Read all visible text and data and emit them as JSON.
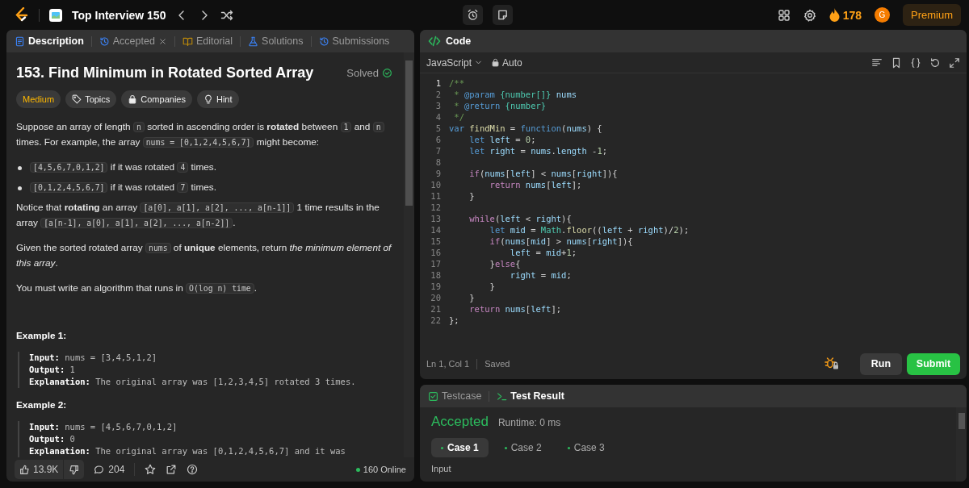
{
  "top_bar": {
    "list_title": "Top Interview 150",
    "streak": "178",
    "avatar": "G",
    "premium": "Premium"
  },
  "description_tabs": [
    {
      "label": "Description",
      "selected": true,
      "closable": false
    },
    {
      "label": "Accepted",
      "selected": false,
      "closable": true
    },
    {
      "label": "Editorial",
      "selected": false,
      "closable": false
    },
    {
      "label": "Solutions",
      "selected": false,
      "closable": false
    },
    {
      "label": "Submissions",
      "selected": false,
      "closable": false
    }
  ],
  "problem": {
    "title": "153. Find Minimum in Rotated Sorted Array",
    "status": "Solved",
    "difficulty": "Medium",
    "tags": [
      "Topics",
      "Companies",
      "Hint"
    ],
    "statement": [
      {
        "kind": "para",
        "parts": [
          {
            "text": "Suppose an array of length "
          },
          {
            "code": "n"
          },
          {
            "text": " sorted in ascending order is **rotated** between "
          },
          {
            "code": "1"
          },
          {
            "text": " and "
          },
          {
            "code": "n"
          },
          {
            "text": " times. For example, the array "
          },
          {
            "code": "nums = [0,1,2,4,5,6,7]"
          },
          {
            "text": " might become:"
          }
        ]
      },
      {
        "kind": "bullet",
        "parts": [
          {
            "code": "[4,5,6,7,0,1,2]"
          },
          {
            "text": " if it was rotated "
          },
          {
            "code": "4"
          },
          {
            "text": " times."
          }
        ]
      },
      {
        "kind": "bullet",
        "parts": [
          {
            "code": "[0,1,2,4,5,6,7]"
          },
          {
            "text": " if it was rotated "
          },
          {
            "code": "7"
          },
          {
            "text": " times."
          }
        ]
      },
      {
        "kind": "para",
        "parts": [
          {
            "text": "Notice that **rotating** an array "
          },
          {
            "code": "[a[0], a[1], a[2], ..., a[n-1]]"
          },
          {
            "text": " 1 time results in the array "
          },
          {
            "code": "[a[n-1], a[0], a[1], a[2], ..., a[n-2]]"
          },
          {
            "text": "."
          }
        ]
      },
      {
        "kind": "para",
        "parts": [
          {
            "text": "Given the sorted rotated array "
          },
          {
            "code": "nums"
          },
          {
            "text": " of **unique** elements, return *the minimum element of this array*."
          }
        ]
      },
      {
        "kind": "para",
        "parts": [
          {
            "text": "You must write an algorithm that runs in "
          },
          {
            "code": "O(log n) time"
          },
          {
            "text": "."
          }
        ]
      }
    ],
    "examples": [
      {
        "title": "Example 1:",
        "lines": [
          "**Input:** nums = [3,4,5,1,2]",
          "**Output:** 1",
          "**Explanation:** The original array was [1,2,3,4,5] rotated 3 times."
        ]
      },
      {
        "title": "Example 2:",
        "lines": [
          "**Input:** nums = [4,5,6,7,0,1,2]",
          "**Output:** 0",
          "**Explanation:** The original array was [0,1,2,4,5,6,7] and it was"
        ]
      }
    ]
  },
  "footer": {
    "likes": "13.9K",
    "comments": "204",
    "online": "160 Online"
  },
  "code_panel": {
    "title": "Code",
    "language": "JavaScript",
    "mode": "Auto",
    "lines": [
      {
        "number": "1",
        "current": true,
        "tokens": [
          {
            "kind": "cm",
            "text": "/**"
          }
        ]
      },
      {
        "number": "2",
        "current": false,
        "tokens": [
          {
            "kind": "cm",
            "text": " * "
          },
          {
            "kind": "doc",
            "text": "@param"
          },
          {
            "kind": "type",
            "text": " {number[]}"
          },
          {
            "kind": "var",
            "text": " nums"
          }
        ]
      },
      {
        "number": "3",
        "current": false,
        "tokens": [
          {
            "kind": "cm",
            "text": " * "
          },
          {
            "kind": "doc",
            "text": "@return"
          },
          {
            "kind": "type",
            "text": " {number}"
          }
        ]
      },
      {
        "number": "4",
        "current": false,
        "tokens": [
          {
            "kind": "cm",
            "text": " */"
          }
        ]
      },
      {
        "number": "5",
        "current": false,
        "tokens": [
          {
            "kind": "kw",
            "text": "var"
          },
          {
            "kind": "fn",
            "text": " findMin"
          },
          {
            "kind": "p",
            "text": " = "
          },
          {
            "kind": "kw",
            "text": "function"
          },
          {
            "kind": "p",
            "text": "("
          },
          {
            "kind": "var",
            "text": "nums"
          },
          {
            "kind": "p",
            "text": ") {"
          }
        ]
      },
      {
        "number": "6",
        "current": false,
        "tokens": [
          {
            "kind": "kw",
            "text": "    let"
          },
          {
            "kind": "var",
            "text": " left"
          },
          {
            "kind": "p",
            "text": " = "
          },
          {
            "kind": "num",
            "text": "0"
          },
          {
            "kind": "p",
            "text": ";"
          }
        ]
      },
      {
        "number": "7",
        "current": false,
        "tokens": [
          {
            "kind": "kw",
            "text": "    let"
          },
          {
            "kind": "var",
            "text": " right"
          },
          {
            "kind": "p",
            "text": " = "
          },
          {
            "kind": "var",
            "text": "nums"
          },
          {
            "kind": "p",
            "text": "."
          },
          {
            "kind": "var",
            "text": "length"
          },
          {
            "kind": "p",
            "text": " -"
          },
          {
            "kind": "num",
            "text": "1"
          },
          {
            "kind": "p",
            "text": ";"
          }
        ]
      },
      {
        "number": "8",
        "current": false
      },
      {
        "number": "9",
        "current": false,
        "tokens": [
          {
            "kind": "ctl",
            "text": "    if"
          },
          {
            "kind": "p",
            "text": "("
          },
          {
            "kind": "var",
            "text": "nums"
          },
          {
            "kind": "p",
            "text": "["
          },
          {
            "kind": "var",
            "text": "left"
          },
          {
            "kind": "p",
            "text": "] < "
          },
          {
            "kind": "var",
            "text": "nums"
          },
          {
            "kind": "p",
            "text": "["
          },
          {
            "kind": "var",
            "text": "right"
          },
          {
            "kind": "p",
            "text": "]){"
          }
        ]
      },
      {
        "number": "10",
        "current": false,
        "tokens": [
          {
            "kind": "ctl",
            "text": "        return"
          },
          {
            "kind": "var",
            "text": " nums"
          },
          {
            "kind": "p",
            "text": "["
          },
          {
            "kind": "var",
            "text": "left"
          },
          {
            "kind": "p",
            "text": "];"
          }
        ]
      },
      {
        "number": "11",
        "current": false,
        "tokens": [
          {
            "kind": "p",
            "text": "    }"
          }
        ]
      },
      {
        "number": "12",
        "current": false
      },
      {
        "number": "13",
        "current": false,
        "tokens": [
          {
            "kind": "ctl",
            "text": "    while"
          },
          {
            "kind": "p",
            "text": "("
          },
          {
            "kind": "var",
            "text": "left"
          },
          {
            "kind": "p",
            "text": " < "
          },
          {
            "kind": "var",
            "text": "right"
          },
          {
            "kind": "p",
            "text": "){"
          }
        ]
      },
      {
        "number": "14",
        "current": false,
        "tokens": [
          {
            "kind": "kw",
            "text": "        let"
          },
          {
            "kind": "var",
            "text": " mid"
          },
          {
            "kind": "p",
            "text": " = "
          },
          {
            "kind": "cls",
            "text": "Math"
          },
          {
            "kind": "p",
            "text": "."
          },
          {
            "kind": "fn2",
            "text": "floor"
          },
          {
            "kind": "p",
            "text": "(("
          },
          {
            "kind": "var",
            "text": "left"
          },
          {
            "kind": "p",
            "text": " + "
          },
          {
            "kind": "var",
            "text": "right"
          },
          {
            "kind": "p",
            "text": ")/"
          },
          {
            "kind": "num",
            "text": "2"
          },
          {
            "kind": "p",
            "text": ");"
          }
        ]
      },
      {
        "number": "15",
        "current": false,
        "tokens": [
          {
            "kind": "ctl",
            "text": "        if"
          },
          {
            "kind": "p",
            "text": "("
          },
          {
            "kind": "var",
            "text": "nums"
          },
          {
            "kind": "p",
            "text": "["
          },
          {
            "kind": "var",
            "text": "mid"
          },
          {
            "kind": "p",
            "text": "] > "
          },
          {
            "kind": "var",
            "text": "nums"
          },
          {
            "kind": "p",
            "text": "["
          },
          {
            "kind": "var",
            "text": "right"
          },
          {
            "kind": "p",
            "text": "]){"
          }
        ]
      },
      {
        "number": "16",
        "current": false,
        "tokens": [
          {
            "kind": "var",
            "text": "            left"
          },
          {
            "kind": "p",
            "text": " = "
          },
          {
            "kind": "var",
            "text": "mid"
          },
          {
            "kind": "p",
            "text": "+"
          },
          {
            "kind": "num",
            "text": "1"
          },
          {
            "kind": "p",
            "text": ";"
          }
        ]
      },
      {
        "number": "17",
        "current": false,
        "tokens": [
          {
            "kind": "p",
            "text": "        }"
          },
          {
            "kind": "ctl",
            "text": "else"
          },
          {
            "kind": "p",
            "text": "{"
          }
        ]
      },
      {
        "number": "18",
        "current": false,
        "tokens": [
          {
            "kind": "var",
            "text": "            right"
          },
          {
            "kind": "p",
            "text": " = "
          },
          {
            "kind": "var",
            "text": "mid"
          },
          {
            "kind": "p",
            "text": ";"
          }
        ]
      },
      {
        "number": "19",
        "current": false,
        "tokens": [
          {
            "kind": "p",
            "text": "        }"
          }
        ]
      },
      {
        "number": "20",
        "current": false,
        "tokens": [
          {
            "kind": "p",
            "text": "    }"
          }
        ]
      },
      {
        "number": "21",
        "current": false,
        "tokens": [
          {
            "kind": "ctl",
            "text": "    return"
          },
          {
            "kind": "var",
            "text": " nums"
          },
          {
            "kind": "p",
            "text": "["
          },
          {
            "kind": "var",
            "text": "left"
          },
          {
            "kind": "p",
            "text": "];"
          }
        ]
      },
      {
        "number": "22",
        "current": false,
        "tokens": [
          {
            "kind": "p",
            "text": "};"
          }
        ]
      }
    ],
    "cursor": "Ln 1, Col 1",
    "save_state": "Saved",
    "run": "Run",
    "submit": "Submit"
  },
  "result_panel": {
    "tabs": [
      {
        "label": "Testcase",
        "selected": false
      },
      {
        "label": "Test Result",
        "selected": true
      }
    ],
    "verdict": "Accepted",
    "runtime": "Runtime: 0 ms",
    "cases": [
      {
        "label": "Case 1",
        "selected": true
      },
      {
        "label": "Case 2",
        "selected": false
      },
      {
        "label": "Case 3",
        "selected": false
      }
    ],
    "section": "Input"
  }
}
